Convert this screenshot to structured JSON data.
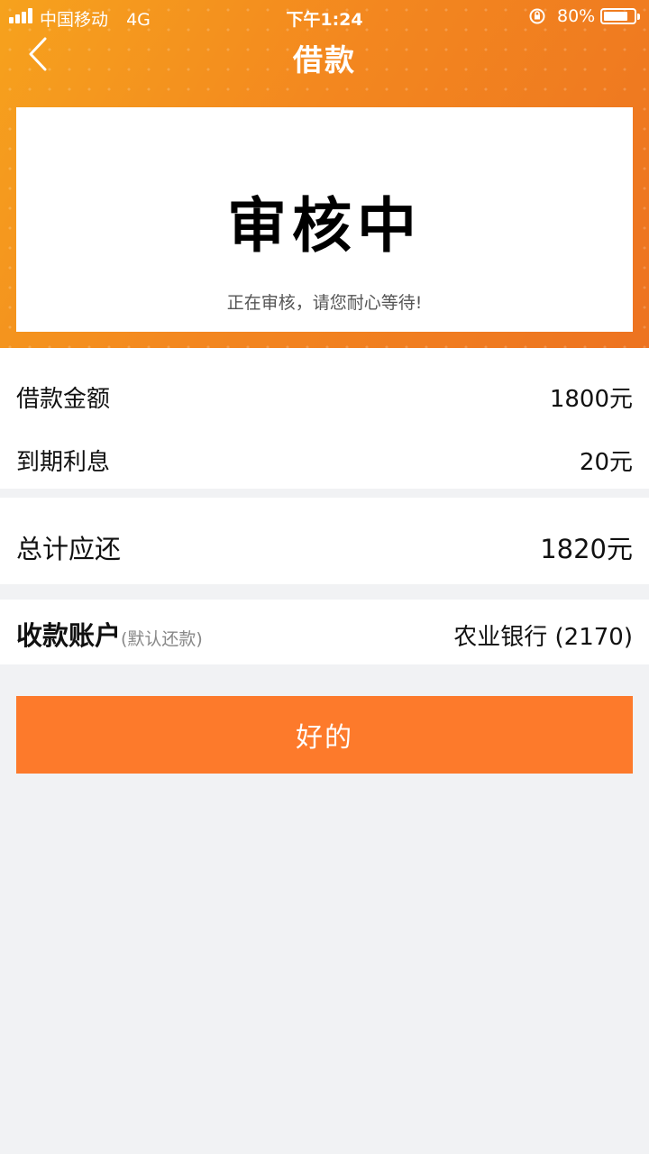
{
  "status_bar": {
    "carrier": "中国移动",
    "network": "4G",
    "time": "下午1:24",
    "battery_percent": "80%",
    "battery_level": 0.8
  },
  "nav": {
    "back_icon": "chevron-left-icon",
    "title": "借款"
  },
  "review_card": {
    "status": "审核中",
    "message": "正在审核，请您耐心等待!"
  },
  "loan_details": [
    {
      "label": "借款金额",
      "value": "1800元"
    },
    {
      "label": "到期利息",
      "value": "20元"
    }
  ],
  "total": {
    "label": "总计应还",
    "value": "1820元"
  },
  "account": {
    "label": "收款账户",
    "hint": "(默认还款)",
    "value": "农业银行 (2170)"
  },
  "confirm_button": {
    "label": "好的"
  },
  "colors": {
    "header_gradient_start": "#f6a21d",
    "header_gradient_end": "#ed7320",
    "button": "#fd7a2b",
    "background": "#f1f2f4"
  }
}
